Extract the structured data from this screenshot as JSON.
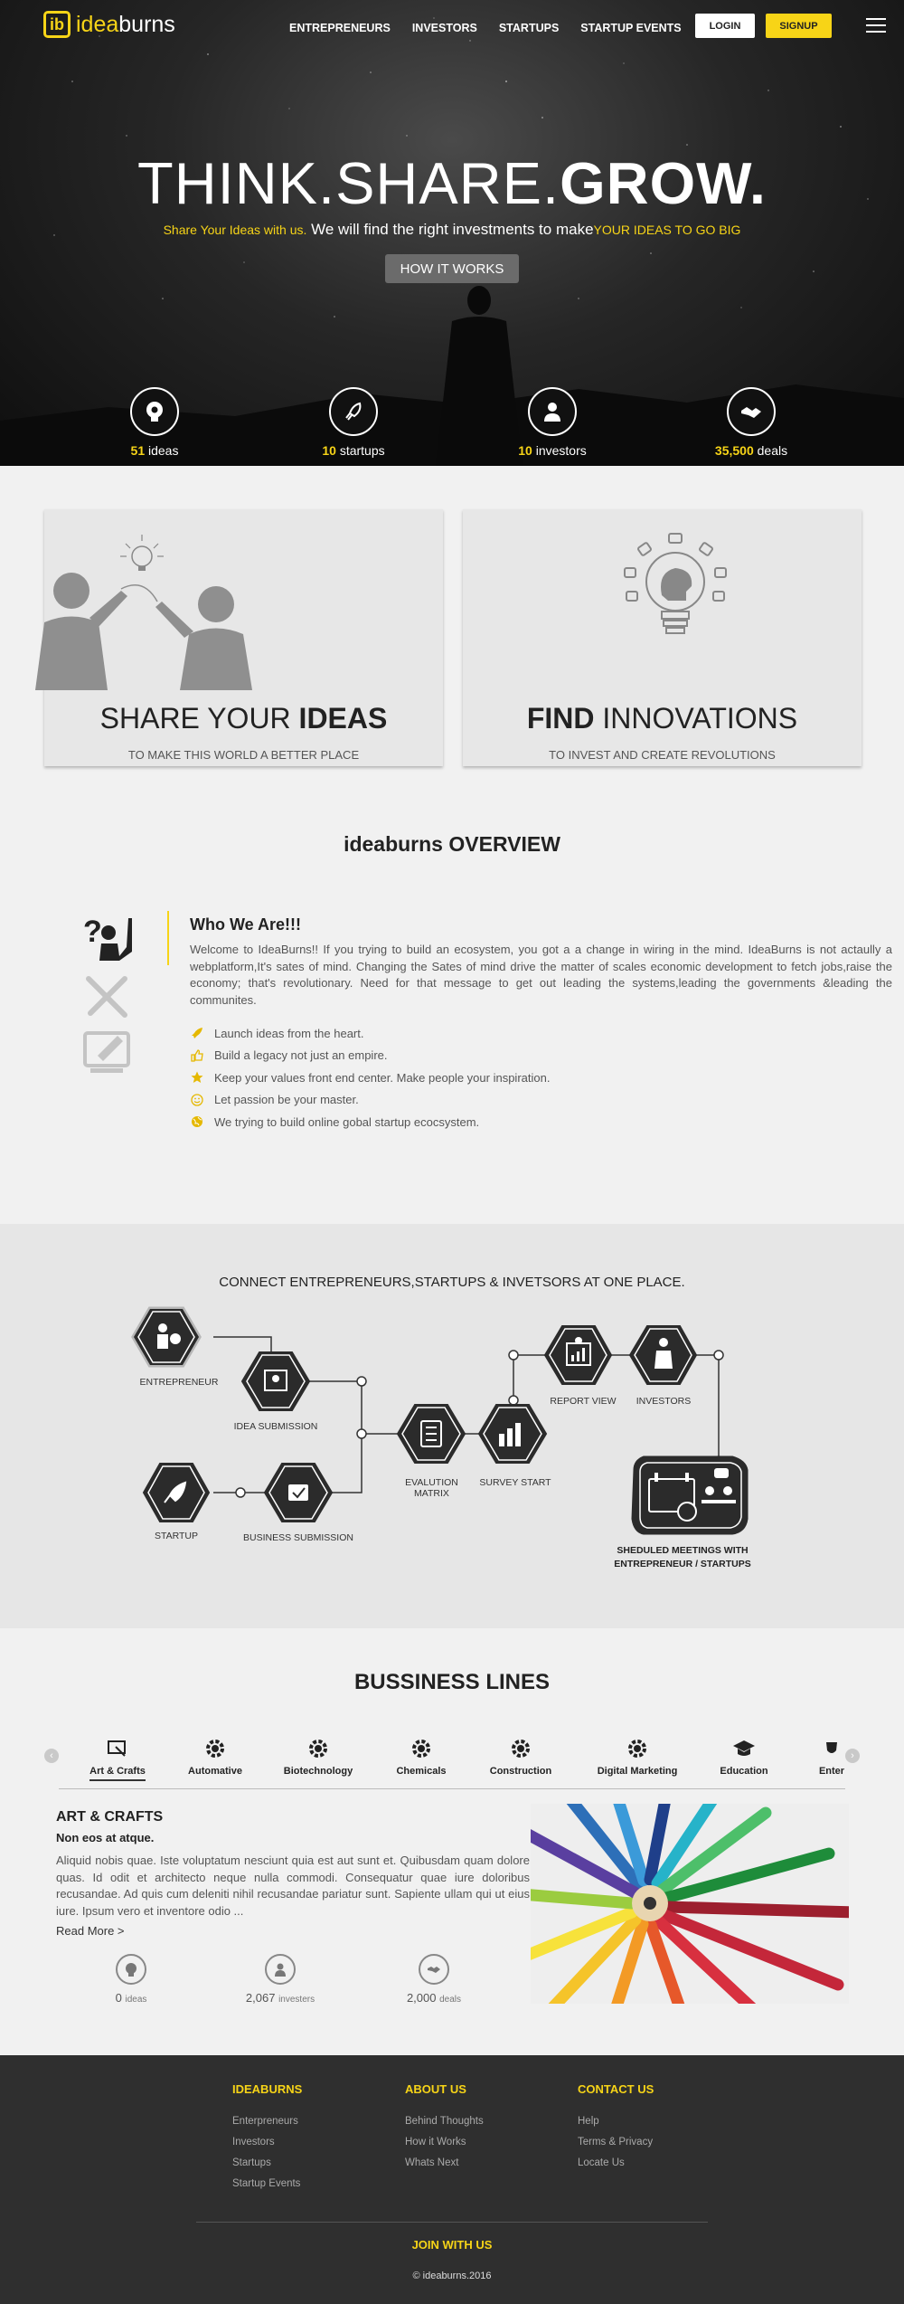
{
  "nav": {
    "logo_mark": "ib",
    "logo_idea": "idea",
    "logo_burns": "burns",
    "links": [
      "ENTREPRENEURS",
      "INVESTORS",
      "STARTUPS",
      "STARTUP EVENTS"
    ],
    "login": "LOGIN",
    "signup": "SIGNUP"
  },
  "hero": {
    "title_light": "THINK.SHARE.",
    "title_bold": "GROW.",
    "sub_yellow1": "Share Your Ideas with us.",
    "sub_white": " We will find the right investments to make",
    "sub_yellow2": "YOUR IDEAS TO GO BIG",
    "button": "HOW IT WORKS",
    "stats": [
      {
        "num": "51",
        "label": "ideas",
        "icon": "idea-head-icon"
      },
      {
        "num": "10",
        "label": "startups",
        "icon": "rocket-icon"
      },
      {
        "num": "10",
        "label": "investors",
        "icon": "investor-icon"
      },
      {
        "num": "35,500",
        "label": "deals",
        "icon": "handshake-icon"
      }
    ]
  },
  "cards": [
    {
      "heading_light": "SHARE YOUR ",
      "heading_bold": "IDEAS",
      "sub": "TO MAKE THIS WORLD A BETTER PLACE"
    },
    {
      "heading_bold": "FIND",
      "heading_light": " INNOVATIONS",
      "sub": "TO INVEST AND CREATE REVOLUTIONS"
    }
  ],
  "overview": {
    "title_bold": "ideaburns",
    "title_light": " OVERVIEW",
    "heading": "Who We Are!!!",
    "paragraph": "Welcome to IdeaBurns!! If you trying to build an ecosystem, you got a a change in wiring in the mind. IdeaBurns is not actaully a webplatform,It's sates of mind. Changing the Sates of mind drive the matter of scales economic development to fetch jobs,raise the economy; that's revolutionary. Need for that message to get out leading the systems,leading the governments &leading the communites.",
    "list": [
      {
        "text": "Launch ideas from the heart.",
        "icon": "rocket-icon"
      },
      {
        "text": "Build a legacy not just an empire.",
        "icon": "thumbs-up-icon"
      },
      {
        "text": "Keep your values front end center. Make people your inspiration.",
        "icon": "star-icon"
      },
      {
        "text": "Let passion be your master.",
        "icon": "smiley-icon"
      },
      {
        "text": "We trying to build online gobal startup ecocsystem.",
        "icon": "globe-icon"
      }
    ]
  },
  "flow": {
    "title": "CONNECT ENTREPRENEURS,STARTUPS & INVETSORS AT ONE PLACE.",
    "labels": {
      "entrepreneur": "ENTREPRENEUR",
      "idea_submission": "IDEA SUBMISSION",
      "startup": "STARTUP",
      "business_submission": "BUSINESS SUBMISSION",
      "evaluation_1": "EVALUTION",
      "evaluation_2": "MATRIX",
      "survey": "SURVEY START",
      "report": "REPORT VIEW",
      "investors": "INVESTORS",
      "meetings_1": "SHEDULED MEETINGS WITH",
      "meetings_2": "ENTREPRENEUR / STARTUPS"
    }
  },
  "business": {
    "title": "BUSSINESS LINES",
    "tabs": [
      {
        "label": "Art & Crafts",
        "icon": "art-icon"
      },
      {
        "label": "Automative",
        "icon": "gear-icon"
      },
      {
        "label": "Biotechnology",
        "icon": "gear-icon"
      },
      {
        "label": "Chemicals",
        "icon": "gear-icon"
      },
      {
        "label": "Construction",
        "icon": "gear-icon"
      },
      {
        "label": "Digital Marketing",
        "icon": "gear-icon"
      },
      {
        "label": "Education",
        "icon": "graduation-cap-icon"
      },
      {
        "label": "Enter",
        "icon": "mask-icon"
      }
    ],
    "heading": "ART & CRAFTS",
    "subheading": "Non eos at atque.",
    "paragraph": "Aliquid nobis quae. Iste voluptatum nesciunt quia est aut sunt et. Quibusdam quam dolore quas. Id odit et architecto neque nulla commodi. Consequatur quae iure doloribus recusandae. Ad quis cum deleniti nihil recusandae pariatur sunt. Sapiente ullam qui ut eius iure. Ipsum vero et inventore odio ...",
    "read_more": "Read More >",
    "stats": [
      {
        "num": "0",
        "label": "ideas"
      },
      {
        "num": "2,067",
        "label": "investers"
      },
      {
        "num": "2,000",
        "label": "deals"
      }
    ]
  },
  "footer": {
    "columns": [
      {
        "title": "IDEABURNS",
        "links": [
          "Enterpreneurs",
          "Investors",
          "Startups",
          "Startup Events"
        ]
      },
      {
        "title": "ABOUT US",
        "links": [
          "Behind Thoughts",
          "How it Works",
          "Whats Next"
        ]
      },
      {
        "title": "CONTACT US",
        "links": [
          "Help",
          "Terms & Privacy",
          "Locate Us"
        ]
      }
    ],
    "join": "JOIN WITH US",
    "copyright": "© ideaburns.2016"
  },
  "colors": {
    "accent": "#f7d417",
    "dark": "#2f2f2f",
    "hex_fill": "#2b2b2b"
  }
}
